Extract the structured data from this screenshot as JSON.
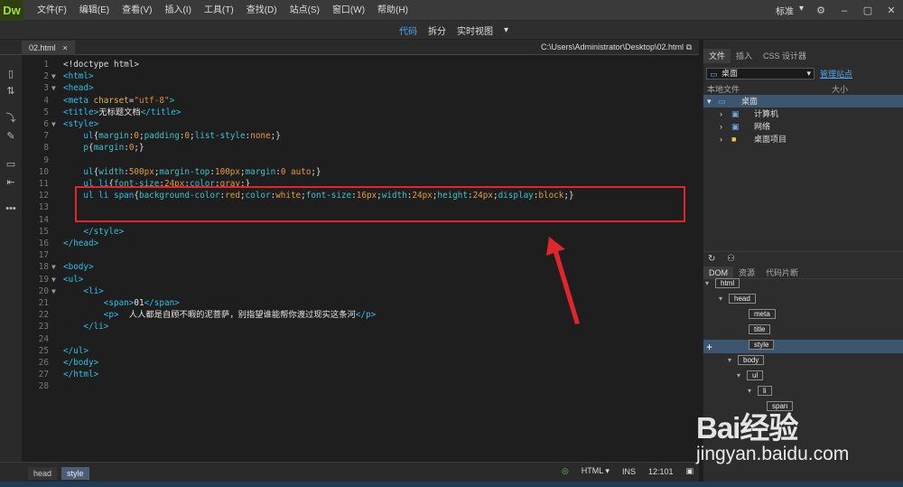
{
  "app": {
    "logo": "Dw"
  },
  "menu": [
    "文件(F)",
    "编辑(E)",
    "查看(V)",
    "插入(I)",
    "工具(T)",
    "查找(D)",
    "站点(S)",
    "窗口(W)",
    "帮助(H)"
  ],
  "layout_mode": "标准",
  "view_tabs": [
    {
      "label": "代码",
      "active": true
    },
    {
      "label": "拆分",
      "active": false
    },
    {
      "label": "实时视图",
      "active": false
    }
  ],
  "document": {
    "tab": "02.html",
    "path": "C:\\Users\\Administrator\\Desktop\\02.html"
  },
  "code_lines": [
    {
      "n": "1",
      "fold": "",
      "html": "<span class='c-pl'>&lt;!doctype html&gt;</span>"
    },
    {
      "n": "2",
      "fold": "▼",
      "html": "<span class='c-tag'>&lt;html&gt;</span>"
    },
    {
      "n": "3",
      "fold": "▼",
      "html": "<span class='c-tag'>&lt;head&gt;</span>"
    },
    {
      "n": "4",
      "fold": "",
      "html": "<span class='c-tag'>&lt;meta </span><span class='c-attr'>charset</span><span class='c-pl'>=</span><span class='c-str'>\"utf-8\"</span><span class='c-tag'>&gt;</span>"
    },
    {
      "n": "5",
      "fold": "",
      "html": "<span class='c-tag'>&lt;title&gt;</span><span class='c-txt'>无标题文档</span><span class='c-tag'>&lt;/title&gt;</span>"
    },
    {
      "n": "6",
      "fold": "▼",
      "html": "<span class='c-tag'>&lt;style&gt;</span>"
    },
    {
      "n": "7",
      "fold": "",
      "html": "    <span class='c-sel'>ul</span><span class='c-pl'>{</span><span class='c-prop'>margin</span><span class='c-pl'>:</span><span class='c-val'>0</span><span class='c-pl'>;</span><span class='c-prop'>padding</span><span class='c-pl'>:</span><span class='c-val'>0</span><span class='c-pl'>;</span><span class='c-prop'>list-style</span><span class='c-pl'>:</span><span class='c-val'>none</span><span class='c-pl'>;}</span>"
    },
    {
      "n": "8",
      "fold": "",
      "html": "    <span class='c-sel'>p</span><span class='c-pl'>{</span><span class='c-prop'>margin</span><span class='c-pl'>:</span><span class='c-val'>0</span><span class='c-pl'>;}</span>"
    },
    {
      "n": "9",
      "fold": "",
      "html": ""
    },
    {
      "n": "10",
      "fold": "",
      "html": "    <span class='c-sel'>ul</span><span class='c-pl'>{</span><span class='c-prop'>width</span><span class='c-pl'>:</span><span class='c-val'>500px</span><span class='c-pl'>;</span><span class='c-prop'>margin-top</span><span class='c-pl'>:</span><span class='c-val'>100px</span><span class='c-pl'>;</span><span class='c-prop'>margin</span><span class='c-pl'>:</span><span class='c-val'>0 auto</span><span class='c-pl'>;}</span>"
    },
    {
      "n": "11",
      "fold": "",
      "html": "    <span class='c-sel'>ul li</span><span class='c-pl'>{</span><span class='c-prop'>font-size</span><span class='c-pl'>:</span><span class='c-val'>24px</span><span class='c-pl'>;</span><span class='c-prop'>color</span><span class='c-pl'>:</span><span class='c-val'>gray</span><span class='c-pl'>;}</span>"
    },
    {
      "n": "12",
      "fold": "",
      "html": "    <span class='c-sel'>ul li span</span><span class='c-pl'>{</span><span class='c-prop'>background-color</span><span class='c-pl'>:</span><span class='c-val'>red</span><span class='c-pl'>;</span><span class='c-prop'>color</span><span class='c-pl'>:</span><span class='c-val'>white</span><span class='c-pl'>;</span><span class='c-prop'>font-size</span><span class='c-pl'>:</span><span class='c-val'>16px</span><span class='c-pl'>;</span><span class='c-prop'>width</span><span class='c-pl'>:</span><span class='c-val'>24px</span><span class='c-pl'>;</span><span class='c-prop'>height</span><span class='c-pl'>:</span><span class='c-val'>24px</span><span class='c-pl'>;</span><span class='c-prop'>display</span><span class='c-pl'>:</span><span class='c-val'>block</span><span class='c-pl'>;}</span>"
    },
    {
      "n": "13",
      "fold": "",
      "html": ""
    },
    {
      "n": "14",
      "fold": "",
      "html": ""
    },
    {
      "n": "15",
      "fold": "",
      "html": "    <span class='c-tag'>&lt;/style&gt;</span>"
    },
    {
      "n": "16",
      "fold": "",
      "html": "<span class='c-tag'>&lt;/head&gt;</span>"
    },
    {
      "n": "17",
      "fold": "",
      "html": ""
    },
    {
      "n": "18",
      "fold": "▼",
      "html": "<span class='c-tag'>&lt;body&gt;</span>"
    },
    {
      "n": "19",
      "fold": "▼",
      "html": "<span class='c-tag'>&lt;ul&gt;</span>"
    },
    {
      "n": "20",
      "fold": "▼",
      "html": "    <span class='c-tag'>&lt;li&gt;</span>"
    },
    {
      "n": "21",
      "fold": "",
      "html": "        <span class='c-tag'>&lt;span&gt;</span><span class='c-txt'>01</span><span class='c-tag'>&lt;/span&gt;</span>"
    },
    {
      "n": "22",
      "fold": "",
      "html": "        <span class='c-tag'>&lt;p&gt;</span><span class='c-txt'>  人人都是自顾不暇的泥菩萨，别指望谁能帮你渡过现实这条河</span><span class='c-tag'>&lt;/p&gt;</span>"
    },
    {
      "n": "23",
      "fold": "",
      "html": "    <span class='c-tag'>&lt;/li&gt;</span>"
    },
    {
      "n": "24",
      "fold": "",
      "html": ""
    },
    {
      "n": "25",
      "fold": "",
      "html": "<span class='c-tag'>&lt;/ul&gt;</span>"
    },
    {
      "n": "26",
      "fold": "",
      "html": "<span class='c-tag'>&lt;/body&gt;</span>"
    },
    {
      "n": "27",
      "fold": "",
      "html": "<span class='c-tag'>&lt;/html&gt;</span>"
    },
    {
      "n": "28",
      "fold": "",
      "html": ""
    }
  ],
  "status": {
    "crumbs": [
      "head",
      "style"
    ],
    "language": "HTML",
    "mode": "INS",
    "position": "12:101"
  },
  "files_panel": {
    "tabs": [
      "文件",
      "插入",
      "CSS 设计器"
    ],
    "site": "桌面",
    "manage_link": "管理站点",
    "col_local": "本地文件",
    "col_size": "大小",
    "tree": [
      {
        "label": "桌面",
        "level": 0,
        "selected": true
      },
      {
        "label": "计算机",
        "level": 1,
        "selected": false
      },
      {
        "label": "网络",
        "level": 1,
        "selected": false
      },
      {
        "label": "桌面项目",
        "level": 1,
        "selected": false
      }
    ]
  },
  "dom_panel": {
    "tabs": [
      "DOM",
      "资源",
      "代码片断"
    ],
    "nodes": [
      "html",
      "head",
      "meta",
      "title",
      "style",
      "body",
      "ul",
      "li",
      "span"
    ]
  },
  "watermark": {
    "text": "Bai经验",
    "url": "jingyan.baidu.com"
  },
  "colors": {
    "accent": "#4ea6f0",
    "highlight_box": "#e0262a",
    "arrow": "#e0262a"
  }
}
